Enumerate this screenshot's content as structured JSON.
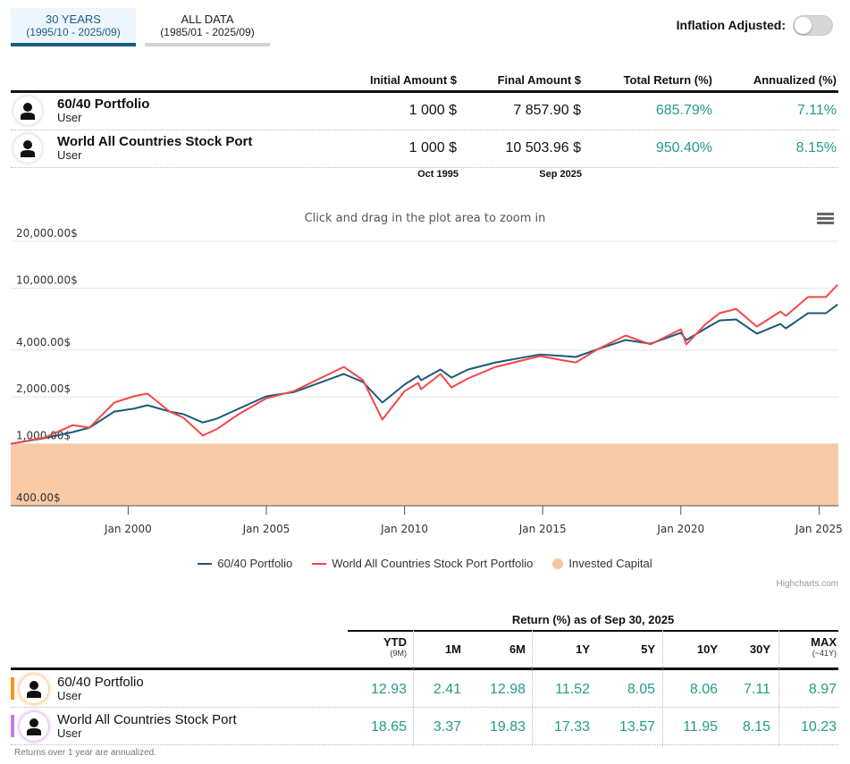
{
  "tabs": [
    {
      "label": "30 YEARS",
      "range": "(1995/10 - 2025/09)",
      "active": true
    },
    {
      "label": "ALL DATA",
      "range": "(1985/01 - 2025/09)",
      "active": false
    }
  ],
  "inflation": {
    "label": "Inflation Adjusted:",
    "on": false
  },
  "summary": {
    "headers": [
      "Initial Amount $",
      "Final Amount $",
      "Total Return (%)",
      "Annualized (%)"
    ],
    "rows": [
      {
        "name": "60/40 Portfolio",
        "user": "User",
        "initial": "1 000 $",
        "final": "7 857.90 $",
        "total": "685.79%",
        "annualized": "7.11%"
      },
      {
        "name": "World All Countries Stock Port",
        "user": "User",
        "initial": "1 000 $",
        "final": "10 503.96 $",
        "total": "950.40%",
        "annualized": "8.15%"
      }
    ],
    "start_date": "Oct 1995",
    "end_date": "Sep 2025"
  },
  "chart_data": {
    "type": "line",
    "subtitle": "Click and drag in the plot area to zoom in",
    "y_scale": "log",
    "ylim": [
      400,
      20000
    ],
    "ytick_labels": [
      {
        "v": 20000,
        "t": "20,000.00$"
      },
      {
        "v": 10000,
        "t": "10,000.00$"
      },
      {
        "v": 4000,
        "t": "4,000.00$"
      },
      {
        "v": 2000,
        "t": "2,000.00$"
      },
      {
        "v": 1000,
        "t": "1,000.00$"
      },
      {
        "v": 400,
        "t": "400.00$"
      }
    ],
    "xlim": [
      1995.75,
      2025.7
    ],
    "xtick_labels": [
      {
        "v": 2000,
        "t": "Jan 2000"
      },
      {
        "v": 2005,
        "t": "Jan 2005"
      },
      {
        "v": 2010,
        "t": "Jan 2010"
      },
      {
        "v": 2015,
        "t": "Jan 2015"
      },
      {
        "v": 2020,
        "t": "Jan 2020"
      },
      {
        "v": 2025,
        "t": "Jan 2025"
      }
    ],
    "series": [
      {
        "name": "60/40 Portfolio",
        "color": "#1b5a78",
        "points": [
          [
            1995.75,
            1000
          ],
          [
            1997.0,
            1090
          ],
          [
            1998.0,
            1190
          ],
          [
            1998.6,
            1270
          ],
          [
            1999.5,
            1610
          ],
          [
            2000.2,
            1680
          ],
          [
            2000.7,
            1770
          ],
          [
            2001.5,
            1610
          ],
          [
            2002.0,
            1550
          ],
          [
            2002.7,
            1370
          ],
          [
            2003.2,
            1450
          ],
          [
            2004.0,
            1680
          ],
          [
            2005.0,
            2020
          ],
          [
            2006.0,
            2150
          ],
          [
            2007.0,
            2490
          ],
          [
            2007.8,
            2810
          ],
          [
            2008.5,
            2490
          ],
          [
            2009.2,
            1840
          ],
          [
            2010.0,
            2400
          ],
          [
            2010.5,
            2730
          ],
          [
            2010.6,
            2560
          ],
          [
            2011.3,
            3000
          ],
          [
            2011.7,
            2660
          ],
          [
            2012.3,
            3000
          ],
          [
            2013.3,
            3330
          ],
          [
            2014.9,
            3750
          ],
          [
            2015.8,
            3660
          ],
          [
            2016.2,
            3610
          ],
          [
            2017.0,
            4060
          ],
          [
            2018.0,
            4640
          ],
          [
            2018.9,
            4400
          ],
          [
            2020.0,
            5170
          ],
          [
            2020.2,
            4640
          ],
          [
            2020.9,
            5510
          ],
          [
            2021.4,
            6200
          ],
          [
            2022.0,
            6290
          ],
          [
            2022.75,
            5100
          ],
          [
            2023.6,
            5880
          ],
          [
            2023.8,
            5510
          ],
          [
            2024.6,
            6900
          ],
          [
            2025.25,
            6900
          ],
          [
            2025.67,
            7858
          ]
        ]
      },
      {
        "name": "World All Countries Stock Port Portfolio",
        "color": "#f44848",
        "points": [
          [
            1995.75,
            1000
          ],
          [
            1997.0,
            1100
          ],
          [
            1998.0,
            1320
          ],
          [
            1998.6,
            1270
          ],
          [
            1999.5,
            1840
          ],
          [
            2000.2,
            2020
          ],
          [
            2000.7,
            2100
          ],
          [
            2001.5,
            1610
          ],
          [
            2002.0,
            1470
          ],
          [
            2002.7,
            1130
          ],
          [
            2003.2,
            1240
          ],
          [
            2004.0,
            1550
          ],
          [
            2005.0,
            1960
          ],
          [
            2006.0,
            2180
          ],
          [
            2007.0,
            2660
          ],
          [
            2007.8,
            3120
          ],
          [
            2008.5,
            2560
          ],
          [
            2009.2,
            1430
          ],
          [
            2010.0,
            2180
          ],
          [
            2010.5,
            2460
          ],
          [
            2010.6,
            2240
          ],
          [
            2011.3,
            2810
          ],
          [
            2011.7,
            2300
          ],
          [
            2012.3,
            2630
          ],
          [
            2013.3,
            3120
          ],
          [
            2014.9,
            3660
          ],
          [
            2015.8,
            3420
          ],
          [
            2016.2,
            3330
          ],
          [
            2017.0,
            4060
          ],
          [
            2018.0,
            4960
          ],
          [
            2018.9,
            4350
          ],
          [
            2020.0,
            5440
          ],
          [
            2020.2,
            4350
          ],
          [
            2020.9,
            5880
          ],
          [
            2021.4,
            6900
          ],
          [
            2022.0,
            7360
          ],
          [
            2022.75,
            5660
          ],
          [
            2023.6,
            7080
          ],
          [
            2023.8,
            6630
          ],
          [
            2024.6,
            8770
          ],
          [
            2025.25,
            8770
          ],
          [
            2025.67,
            10504
          ]
        ]
      },
      {
        "name": "Invested Capital",
        "color": "#f7c49c",
        "type": "area",
        "value": 1000
      }
    ],
    "credits": "Highcharts.com"
  },
  "returns": {
    "title": "Return (%) as of Sep 30, 2025",
    "headers": [
      {
        "t": "YTD",
        "s": "(9M)"
      },
      {
        "t": "1M",
        "s": ""
      },
      {
        "t": "6M",
        "s": ""
      },
      {
        "t": "1Y",
        "s": ""
      },
      {
        "t": "5Y",
        "s": ""
      },
      {
        "t": "10Y",
        "s": ""
      },
      {
        "t": "30Y",
        "s": ""
      },
      {
        "t": "MAX",
        "s": "(~41Y)"
      }
    ],
    "rows": [
      {
        "name": "60/40 Portfolio",
        "user": "User",
        "color": "#f7941d",
        "values": [
          "12.93",
          "2.41",
          "12.98",
          "11.52",
          "8.05",
          "8.06",
          "7.11",
          "8.97"
        ]
      },
      {
        "name": "World All Countries Stock Port",
        "user": "User",
        "color": "#c27ddb",
        "values": [
          "18.65",
          "3.37",
          "19.83",
          "17.33",
          "13.57",
          "11.95",
          "8.15",
          "10.23"
        ]
      }
    ],
    "footnote": "Returns over 1 year are annualized."
  }
}
